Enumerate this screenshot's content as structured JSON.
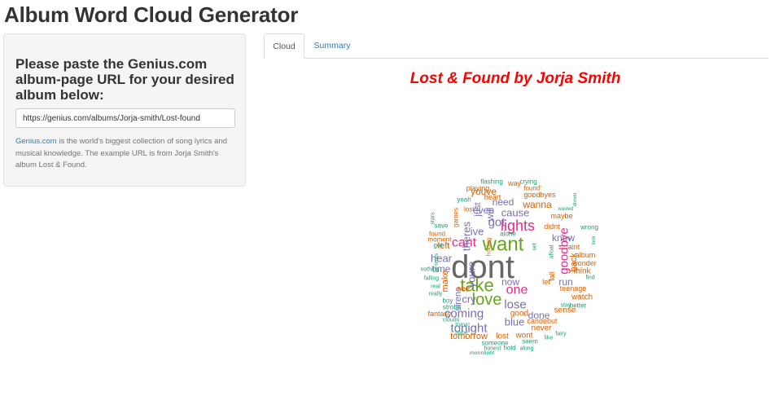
{
  "app": {
    "title": "Album Word Cloud Generator"
  },
  "sidebar": {
    "prompt": "Please paste the Genius.com album-page URL for your desired album below:",
    "url_value": "https://genius.com/albums/Jorja-smith/Lost-found",
    "help_link": "Genius.com",
    "help_text": " is the world's biggest collection of song lyrics and musical knowledge. The example URL is from Jorja Smith's album Lost & Found."
  },
  "tabs": [
    {
      "label": "Cloud",
      "active": true
    },
    {
      "label": "Summary",
      "active": false
    }
  ],
  "plot": {
    "title": "Lost & Found by Jorja Smith"
  },
  "colors": {
    "teal": "#1b9e77",
    "orange": "#d95f02",
    "purple": "#7570b3",
    "pink": "#e7298a",
    "green": "#66a61e",
    "gray": "#666666",
    "title_red": "#ff0000"
  },
  "chart_data": {
    "type": "wordcloud",
    "words": [
      {
        "text": "dont",
        "c": "gray"
      },
      {
        "text": "want",
        "c": "green"
      },
      {
        "text": "take",
        "c": "green"
      },
      {
        "text": "love",
        "c": "green"
      },
      {
        "text": "lights",
        "c": "pink"
      },
      {
        "text": "goodbye",
        "c": "pink"
      },
      {
        "text": "one",
        "c": "pink"
      },
      {
        "text": "cant",
        "c": "pink"
      },
      {
        "text": "got",
        "c": "purple"
      },
      {
        "text": "coming",
        "c": "purple"
      },
      {
        "text": "tonight",
        "c": "purple"
      },
      {
        "text": "lose",
        "c": "purple"
      },
      {
        "text": "blue",
        "c": "purple"
      },
      {
        "text": "cause",
        "c": "purple"
      },
      {
        "text": "youre",
        "c": "purple"
      },
      {
        "text": "theres",
        "c": "purple"
      },
      {
        "text": "ive",
        "c": "purple"
      },
      {
        "text": "cry",
        "c": "purple"
      },
      {
        "text": "hear",
        "c": "purple"
      },
      {
        "text": "time",
        "c": "purple"
      },
      {
        "text": "even",
        "c": "purple"
      },
      {
        "text": "will",
        "c": "purple"
      },
      {
        "text": "just",
        "c": "purple"
      },
      {
        "text": "now",
        "c": "purple"
      },
      {
        "text": "know",
        "c": "purple"
      },
      {
        "text": "need",
        "c": "purple"
      },
      {
        "text": "done",
        "c": "purple"
      },
      {
        "text": "run",
        "c": "purple"
      },
      {
        "text": "sirens",
        "c": "purple"
      },
      {
        "text": "youve",
        "c": "orange"
      },
      {
        "text": "wanna",
        "c": "orange"
      },
      {
        "text": "left",
        "c": "orange"
      },
      {
        "text": "back",
        "c": "orange"
      },
      {
        "text": "make",
        "c": "orange"
      },
      {
        "text": "see",
        "c": "orange"
      },
      {
        "text": "think",
        "c": "orange"
      },
      {
        "text": "watch",
        "c": "orange"
      },
      {
        "text": "good",
        "c": "orange"
      },
      {
        "text": "sense",
        "c": "orange"
      },
      {
        "text": "never",
        "c": "orange"
      },
      {
        "text": "wont",
        "c": "orange"
      },
      {
        "text": "tomorrow",
        "c": "orange"
      },
      {
        "text": "lost",
        "c": "orange"
      },
      {
        "text": "maybe",
        "c": "orange"
      },
      {
        "text": "teenage",
        "c": "orange"
      },
      {
        "text": "aint",
        "c": "orange"
      },
      {
        "text": "wonder",
        "c": "orange"
      },
      {
        "text": "album",
        "c": "orange"
      },
      {
        "text": "candebut",
        "c": "orange"
      },
      {
        "text": "goodbyes",
        "c": "orange"
      },
      {
        "text": "playing",
        "c": "orange"
      },
      {
        "text": "heart",
        "c": "orange"
      },
      {
        "text": "fantasy",
        "c": "orange"
      },
      {
        "text": "let",
        "c": "orange"
      },
      {
        "text": "fall",
        "c": "orange"
      },
      {
        "text": "didnt",
        "c": "orange"
      },
      {
        "text": "games",
        "c": "orange"
      },
      {
        "text": "way",
        "c": "orange"
      },
      {
        "text": "found",
        "c": "orange"
      },
      {
        "text": "moment",
        "c": "orange"
      },
      {
        "text": "holding",
        "c": "orange"
      },
      {
        "text": "lost'",
        "c": "orange"
      },
      {
        "text": "found'",
        "c": "orange"
      },
      {
        "text": "flashing",
        "c": "teal"
      },
      {
        "text": "crying",
        "c": "teal"
      },
      {
        "text": "yeah",
        "c": "teal"
      },
      {
        "text": "save",
        "c": "teal"
      },
      {
        "text": "get",
        "c": "teal"
      },
      {
        "text": "nothing",
        "c": "teal"
      },
      {
        "text": "falling",
        "c": "teal"
      },
      {
        "text": "real",
        "c": "teal"
      },
      {
        "text": "really",
        "c": "teal"
      },
      {
        "text": "boy",
        "c": "teal"
      },
      {
        "text": "strobe",
        "c": "teal"
      },
      {
        "text": "clouds",
        "c": "teal"
      },
      {
        "text": "tryna",
        "c": "teal"
      },
      {
        "text": "babe",
        "c": "teal"
      },
      {
        "text": "someone",
        "c": "teal"
      },
      {
        "text": "honest",
        "c": "teal"
      },
      {
        "text": "moonlight",
        "c": "teal"
      },
      {
        "text": "hold",
        "c": "teal"
      },
      {
        "text": "along",
        "c": "teal"
      },
      {
        "text": "seem",
        "c": "teal"
      },
      {
        "text": "like",
        "c": "teal"
      },
      {
        "text": "fairy",
        "c": "teal"
      },
      {
        "text": "better",
        "c": "teal"
      },
      {
        "text": "stay",
        "c": "teal"
      },
      {
        "text": "find",
        "c": "teal"
      },
      {
        "text": "wrong",
        "c": "teal"
      },
      {
        "text": "look",
        "c": "teal"
      },
      {
        "text": "wasted",
        "c": "teal"
      },
      {
        "text": "drown",
        "c": "teal"
      },
      {
        "text": "alone",
        "c": "teal"
      },
      {
        "text": "set",
        "c": "teal"
      },
      {
        "text": "afloat",
        "c": "teal"
      },
      {
        "text": "times",
        "c": "teal"
      },
      {
        "text": "stars",
        "c": "teal"
      }
    ]
  }
}
